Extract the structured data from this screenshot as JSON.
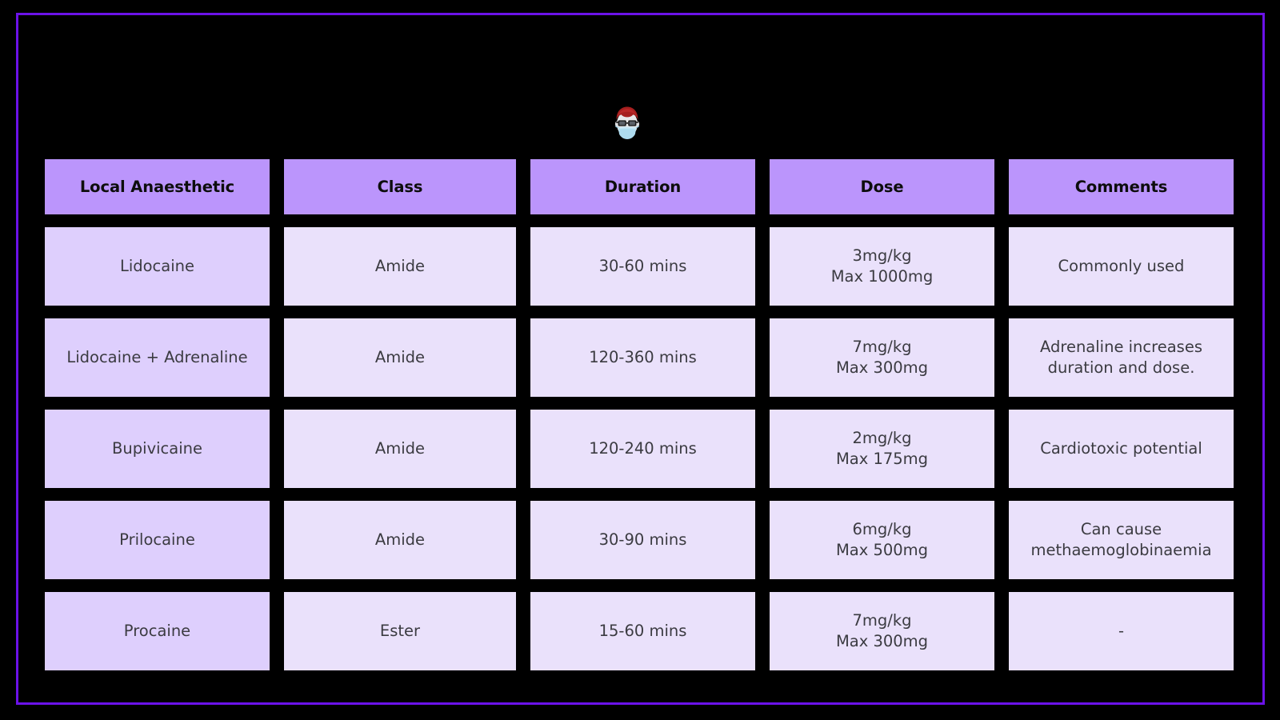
{
  "page": {
    "background_color": "#000000",
    "frame_color": "#6B12E8"
  },
  "avatar": {
    "name": "doctor-avatar",
    "description": "person with red hair, black glasses and blue surgical face mask",
    "hair_color": "#A61F1F",
    "skin_color": "#E8E8EA",
    "mask_color": "#AEDCF0",
    "glasses_color": "#1A1A1A"
  },
  "table": {
    "header_bg": "#BB95FC",
    "header_text_color": "#0D0D0D",
    "cell_bg": "#EAE1FB",
    "first_col_bg": "#DECFFD",
    "cell_text_color": "#3B3B41",
    "columns": [
      "Local Anaesthetic",
      "Class",
      "Duration",
      "Dose",
      "Comments"
    ],
    "rows": [
      {
        "anaesthetic": "Lidocaine",
        "class": "Amide",
        "duration": "30-60 mins",
        "dose_rate": "3mg/kg",
        "dose_max": "Max 1000mg",
        "comments": "Commonly used"
      },
      {
        "anaesthetic": "Lidocaine + Adrenaline",
        "class": "Amide",
        "duration": "120-360 mins",
        "dose_rate": "7mg/kg",
        "dose_max": "Max 300mg",
        "comments": "Adrenaline increases duration and dose."
      },
      {
        "anaesthetic": "Bupivicaine",
        "class": "Amide",
        "duration": "120-240 mins",
        "dose_rate": "2mg/kg",
        "dose_max": "Max 175mg",
        "comments": "Cardiotoxic potential"
      },
      {
        "anaesthetic": "Prilocaine",
        "class": "Amide",
        "duration": "30-90 mins",
        "dose_rate": "6mg/kg",
        "dose_max": "Max 500mg",
        "comments": "Can cause methaemoglobinaemia"
      },
      {
        "anaesthetic": "Procaine",
        "class": "Ester",
        "duration": "15-60 mins",
        "dose_rate": "7mg/kg",
        "dose_max": "Max 300mg",
        "comments": "-"
      }
    ]
  }
}
